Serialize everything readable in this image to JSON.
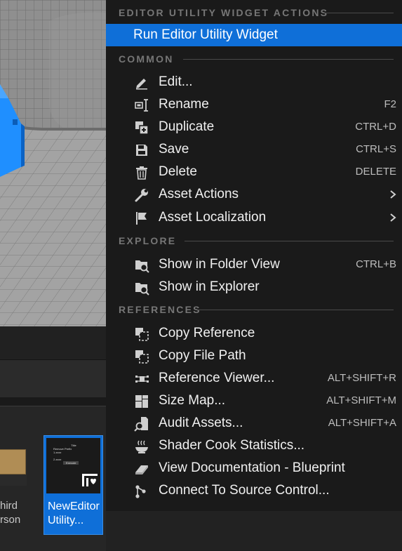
{
  "background": {
    "assets": [
      {
        "label_line1": "hird",
        "label_line2": "rson"
      },
      {
        "label_line1": "NewEditor",
        "label_line2": "Utility...",
        "thumb_title": "Title",
        "thumb_line1": "Remove Prefix",
        "thumb_line2": "1.zzzz",
        "thumb_line3": "2.zzzz",
        "thumb_button": "Execute"
      }
    ]
  },
  "menu": {
    "sections": {
      "editor_utility": "EDITOR UTILITY WIDGET ACTIONS",
      "common": "COMMON",
      "explore": "EXPLORE",
      "references": "REFERENCES"
    },
    "run": {
      "label": "Run Editor Utility Widget"
    },
    "common_items": [
      {
        "label": "Edit...",
        "shortcut": "",
        "icon": "pencil-icon"
      },
      {
        "label": "Rename",
        "shortcut": "F2",
        "icon": "rename-icon"
      },
      {
        "label": "Duplicate",
        "shortcut": "CTRL+D",
        "icon": "duplicate-icon"
      },
      {
        "label": "Save",
        "shortcut": "CTRL+S",
        "icon": "save-icon"
      },
      {
        "label": "Delete",
        "shortcut": "DELETE",
        "icon": "trash-icon"
      },
      {
        "label": "Asset Actions",
        "shortcut": "",
        "icon": "wrench-icon",
        "submenu": true
      },
      {
        "label": "Asset Localization",
        "shortcut": "",
        "icon": "flag-icon",
        "submenu": true
      }
    ],
    "explore_items": [
      {
        "label": "Show in Folder View",
        "shortcut": "CTRL+B",
        "icon": "folder-search-icon"
      },
      {
        "label": "Show in Explorer",
        "shortcut": "",
        "icon": "folder-search-icon"
      }
    ],
    "reference_items": [
      {
        "label": "Copy Reference",
        "shortcut": "",
        "icon": "copy-reference-icon"
      },
      {
        "label": "Copy File Path",
        "shortcut": "",
        "icon": "copy-path-icon"
      },
      {
        "label": "Reference Viewer...",
        "shortcut": "ALT+SHIFT+R",
        "icon": "reference-viewer-icon"
      },
      {
        "label": "Size Map...",
        "shortcut": "ALT+SHIFT+M",
        "icon": "size-map-icon"
      },
      {
        "label": "Audit Assets...",
        "shortcut": "ALT+SHIFT+A",
        "icon": "audit-icon"
      },
      {
        "label": "Shader Cook Statistics...",
        "shortcut": "",
        "icon": "shader-icon"
      },
      {
        "label": "View Documentation - Blueprint",
        "shortcut": "",
        "icon": "documentation-icon"
      },
      {
        "label": "Connect To Source Control...",
        "shortcut": "",
        "icon": "source-control-icon"
      }
    ]
  }
}
